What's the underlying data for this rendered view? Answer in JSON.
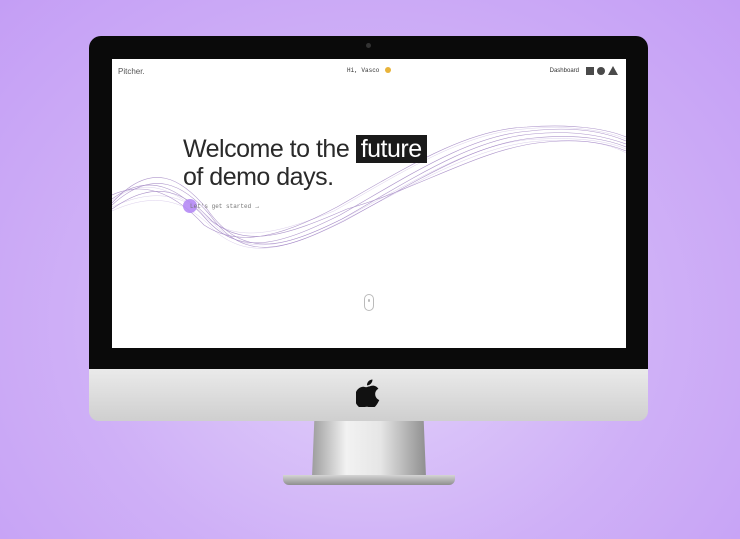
{
  "header": {
    "brand": "Pitcher.",
    "greeting": "Hi, Vasco",
    "nav_link": "Dashboard"
  },
  "hero": {
    "line1_prefix": "Welcome to the",
    "highlight": "future",
    "line2": "of demo days."
  },
  "cta": {
    "label": "Let's get started",
    "arrow": "→"
  },
  "icons": [
    "square-icon",
    "circle-icon",
    "triangle-icon",
    "apple-logo",
    "scroll-mouse-icon"
  ],
  "colors": {
    "background": "#cfb0f7",
    "wave": "#6b3fa0",
    "cta_dot": "#b58af5",
    "highlight_bg": "#1a1a1a"
  }
}
